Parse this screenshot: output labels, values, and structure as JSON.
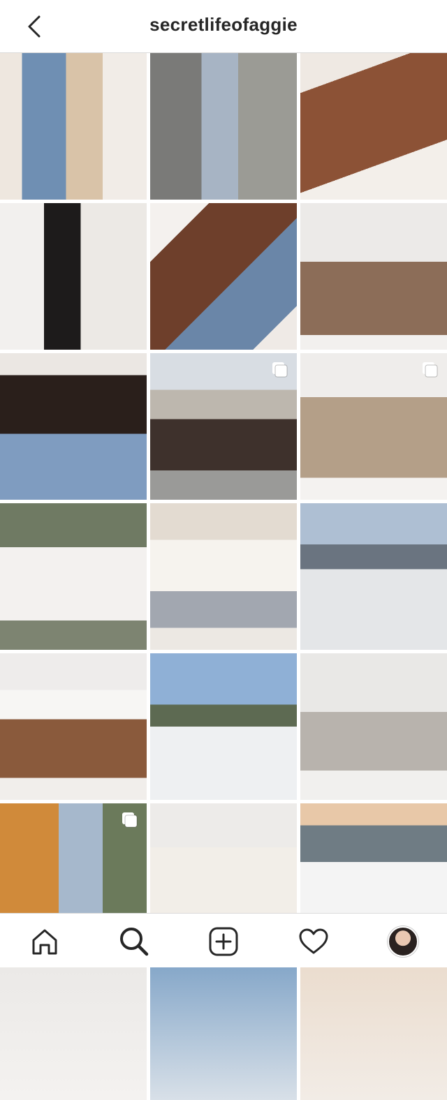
{
  "header": {
    "username": "secretlifeofaggie",
    "back_icon": "chevron-left-icon"
  },
  "posts": [
    {
      "bg": "linear-gradient(90deg,#eee7df 0 15%,#6f8fb3 15% 45%,#d9c3a8 45% 70%,#f1ece7 70%)",
      "multi": false
    },
    {
      "bg": "linear-gradient(90deg,#7a7a78 0 35%,#a7b4c4 35% 60%,#9b9b95 60%)",
      "multi": false
    },
    {
      "bg": "linear-gradient(160deg,#efe9e3 0 20%,#8c5236 20% 70%,#f3efea 70%)",
      "multi": false
    },
    {
      "bg": "linear-gradient(90deg,#f2f0ee 0 30%,#1d1b1b 30% 55%,#ece9e5 55%)",
      "multi": false
    },
    {
      "bg": "linear-gradient(135deg,#f4f1ee 0 20%,#6e3f2b 20% 55%,#6a86a8 55% 85%,#efeae6 85%)",
      "multi": false
    },
    {
      "bg": "linear-gradient(180deg,#eceae8 0 40%,#8c6d58 40% 90%,#f2f0ee 90%)",
      "multi": false
    },
    {
      "bg": "linear-gradient(180deg,#ebe7e3 0 15%,#2a1f1b 15% 55%,#7f9cc0 55%)",
      "multi": false
    },
    {
      "bg": "linear-gradient(180deg,#d8dde3 0 25%,#bdb7ae 25% 45%,#3e312c 45% 80%,#9a9a98 80%)",
      "multi": true
    },
    {
      "bg": "linear-gradient(180deg,#efedeb 0 30%,#b49f88 30% 85%,#f4f2f0 85%)",
      "multi": true
    },
    {
      "bg": "linear-gradient(180deg,#6f7a63 0 30%,#f3f1ef 30% 80%,#7d8471 80%)",
      "multi": false
    },
    {
      "bg": "linear-gradient(180deg,#e3dbd1 0 25%,#f6f3ee 25% 60%,#a2a7b0 60% 85%,#ece8e3 85%)",
      "multi": false
    },
    {
      "bg": "linear-gradient(180deg,#aebfd3 0 28%,#6a7480 28% 45%,#e4e6e8 45%)",
      "multi": false
    },
    {
      "bg": "linear-gradient(180deg,#eeeceb 0 25%,#f7f6f4 25% 45%,#8a5a3c 45% 85%,#f1eeeb 85%)",
      "multi": false
    },
    {
      "bg": "linear-gradient(180deg,#8fb0d6 0 35%,#5d6a52 35% 50%,#eef0f2 50%)",
      "multi": false
    },
    {
      "bg": "linear-gradient(180deg,#e9e8e6 0 40%,#b8b3ad 40% 80%,#f1f0ee 80%)",
      "multi": false
    },
    {
      "bg": "linear-gradient(90deg,#d08a3a 0 40%,#a6b8cc 40% 70%,#6b7a5b 70%)",
      "multi": true
    },
    {
      "bg": "linear-gradient(180deg,#edebe9 0 30%,#f2eee8 30% 85%,#dcd8d4 85%)",
      "multi": false
    },
    {
      "bg": "linear-gradient(180deg,#e8c8a8 0 15%,#6f7c84 15% 40%,#f4f4f4 40% 85%,#bfc4c8 85%)",
      "multi": false
    },
    {
      "bg": "linear-gradient(180deg,#eae8e6 0%,#f4f2f0 100%)",
      "multi": false
    },
    {
      "bg": "linear-gradient(180deg,#7ea2c6 0%,#d8e0e8 100%)",
      "multi": false
    },
    {
      "bg": "linear-gradient(180deg,#eadbcc 0%,#f2ece6 100%)",
      "multi": false
    }
  ],
  "tabbar": {
    "items": [
      "home-icon",
      "search-icon",
      "add-post-icon",
      "heart-icon",
      "profile-avatar"
    ],
    "active": "search-icon"
  }
}
